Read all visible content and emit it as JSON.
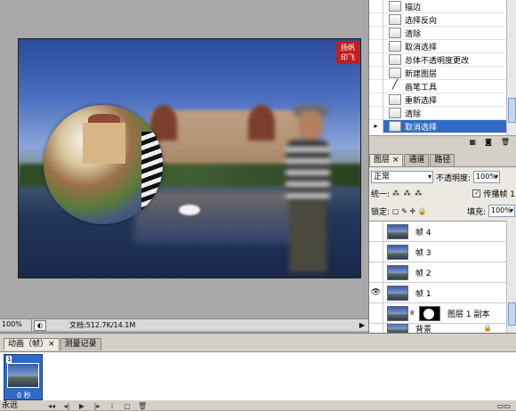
{
  "canvas": {
    "stamp_text": "扬帆印飞"
  },
  "status": {
    "zoom": "100%",
    "doc": "文档:512.7K/14.1M"
  },
  "history": {
    "items": [
      {
        "label": "描边",
        "selected": false
      },
      {
        "label": "选择反向",
        "selected": false
      },
      {
        "label": "清除",
        "selected": false
      },
      {
        "label": "取消选择",
        "selected": false
      },
      {
        "label": "总体不透明度更改",
        "selected": false
      },
      {
        "label": "新建图层",
        "selected": false
      },
      {
        "label": "画笔工具",
        "selected": false
      },
      {
        "label": "重新选择",
        "selected": false
      },
      {
        "label": "清除",
        "selected": false
      },
      {
        "label": "取消选择",
        "selected": true
      }
    ]
  },
  "panel_tabs": [
    {
      "label": "图层 ×",
      "active": true
    },
    {
      "label": "通道",
      "active": false
    },
    {
      "label": "路径",
      "active": false
    }
  ],
  "layers_panel": {
    "blend_mode": "正常",
    "opacity_label": "不透明度:",
    "opacity_value": "100%",
    "unify_label": "统一:",
    "propagate_label": "传播帧 1",
    "lock_label": "锁定:",
    "fill_label": "填充:",
    "fill_value": "100%",
    "layers": [
      {
        "name": "帧 4",
        "visible": false,
        "selected": false,
        "has_mask": false
      },
      {
        "name": "帧 3",
        "visible": false,
        "selected": false,
        "has_mask": false
      },
      {
        "name": "帧 2",
        "visible": false,
        "selected": false,
        "has_mask": false
      },
      {
        "name": "帧 1",
        "visible": true,
        "selected": false,
        "has_mask": false
      },
      {
        "name": "图层 1 副本",
        "visible": false,
        "selected": false,
        "has_mask": true
      },
      {
        "name": "背景",
        "visible": false,
        "selected": false,
        "has_mask": false
      }
    ]
  },
  "animation": {
    "tabs": [
      {
        "label": "动画（帧）×",
        "active": true
      },
      {
        "label": "测量记录",
        "active": false
      }
    ],
    "frame": {
      "number": "1",
      "time": "0 秒"
    },
    "loop": "永远"
  }
}
